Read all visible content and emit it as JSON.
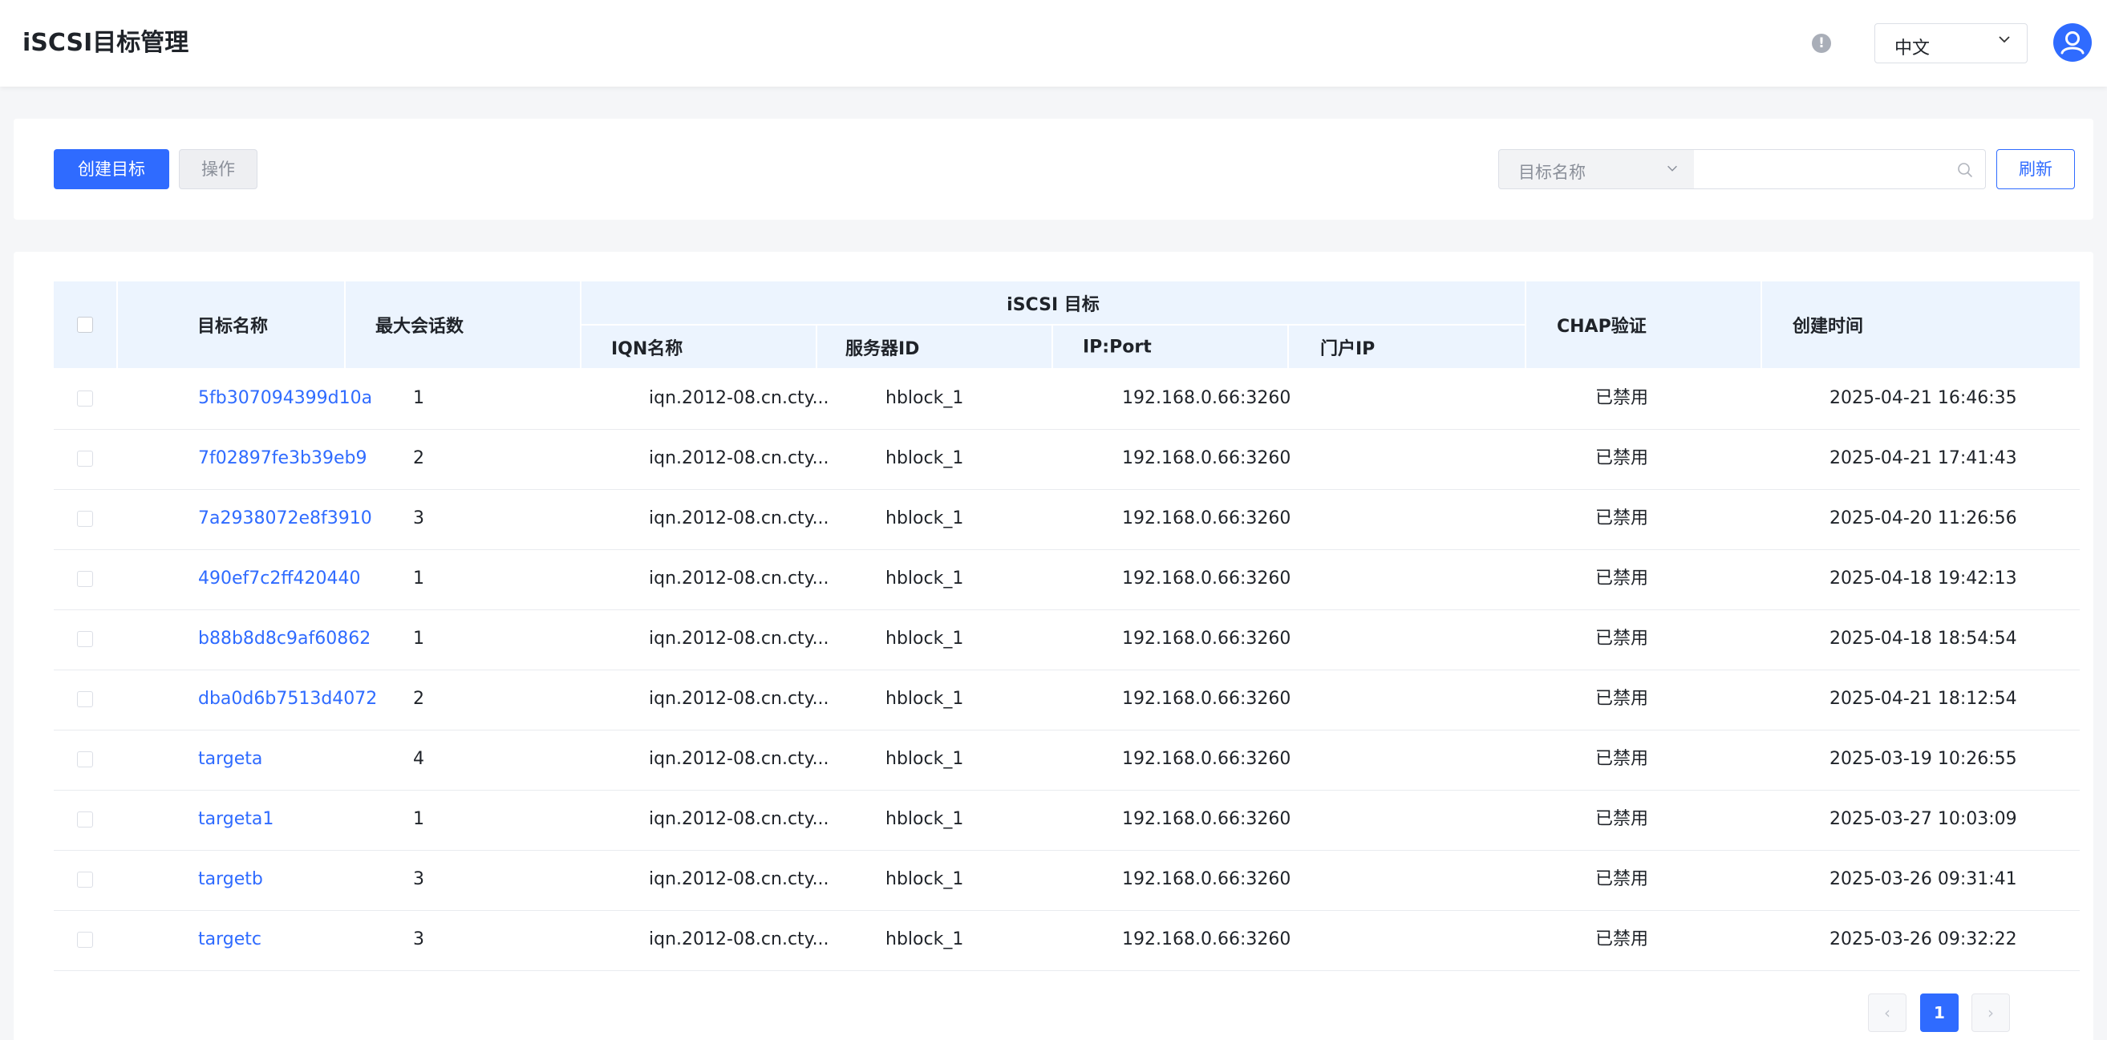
{
  "header": {
    "title": "iSCSI目标管理",
    "help_icon": "info-circle-icon",
    "help_glyph": "!",
    "language": "中文",
    "avatar_icon": "user-avatar-icon",
    "accent": "#2f6bff"
  },
  "toolbar": {
    "create_label": "创建目标",
    "action_label": "操作",
    "filter_value": "目标名称",
    "search_value": "",
    "refresh_label": "刷新"
  },
  "table": {
    "headers": {
      "name": "目标名称",
      "max_sessions": "最大会话数",
      "group": "iSCSI 目标",
      "iqn": "IQN名称",
      "server_id": "服务器ID",
      "ip_port": "IP:Port",
      "portal_ip": "门户IP",
      "chap": "CHAP验证",
      "created": "创建时间"
    },
    "rows": [
      {
        "name": "5fb307094399d10a",
        "max_sessions": "1",
        "iqn": "iqn.2012-08.cn.cty...",
        "server_id": "hblock_1",
        "ip_port": "192.168.0.66:3260",
        "portal_ip": "",
        "chap": "已禁用",
        "created": "2025-04-21 16:46:35"
      },
      {
        "name": "7f02897fe3b39eb9",
        "max_sessions": "2",
        "iqn": "iqn.2012-08.cn.cty...",
        "server_id": "hblock_1",
        "ip_port": "192.168.0.66:3260",
        "portal_ip": "",
        "chap": "已禁用",
        "created": "2025-04-21 17:41:43"
      },
      {
        "name": "7a2938072e8f3910",
        "max_sessions": "3",
        "iqn": "iqn.2012-08.cn.cty...",
        "server_id": "hblock_1",
        "ip_port": "192.168.0.66:3260",
        "portal_ip": "",
        "chap": "已禁用",
        "created": "2025-04-20 11:26:56"
      },
      {
        "name": "490ef7c2ff420440",
        "max_sessions": "1",
        "iqn": "iqn.2012-08.cn.cty...",
        "server_id": "hblock_1",
        "ip_port": "192.168.0.66:3260",
        "portal_ip": "",
        "chap": "已禁用",
        "created": "2025-04-18 19:42:13"
      },
      {
        "name": "b88b8d8c9af60862",
        "max_sessions": "1",
        "iqn": "iqn.2012-08.cn.cty...",
        "server_id": "hblock_1",
        "ip_port": "192.168.0.66:3260",
        "portal_ip": "",
        "chap": "已禁用",
        "created": "2025-04-18 18:54:54"
      },
      {
        "name": "dba0d6b7513d4072",
        "max_sessions": "2",
        "iqn": "iqn.2012-08.cn.cty...",
        "server_id": "hblock_1",
        "ip_port": "192.168.0.66:3260",
        "portal_ip": "",
        "chap": "已禁用",
        "created": "2025-04-21 18:12:54"
      },
      {
        "name": "targeta",
        "max_sessions": "4",
        "iqn": "iqn.2012-08.cn.cty...",
        "server_id": "hblock_1",
        "ip_port": "192.168.0.66:3260",
        "portal_ip": "",
        "chap": "已禁用",
        "created": "2025-03-19 10:26:55"
      },
      {
        "name": "targeta1",
        "max_sessions": "1",
        "iqn": "iqn.2012-08.cn.cty...",
        "server_id": "hblock_1",
        "ip_port": "192.168.0.66:3260",
        "portal_ip": "",
        "chap": "已禁用",
        "created": "2025-03-27 10:03:09"
      },
      {
        "name": "targetb",
        "max_sessions": "3",
        "iqn": "iqn.2012-08.cn.cty...",
        "server_id": "hblock_1",
        "ip_port": "192.168.0.66:3260",
        "portal_ip": "",
        "chap": "已禁用",
        "created": "2025-03-26 09:31:41"
      },
      {
        "name": "targetc",
        "max_sessions": "3",
        "iqn": "iqn.2012-08.cn.cty...",
        "server_id": "hblock_1",
        "ip_port": "192.168.0.66:3260",
        "portal_ip": "",
        "chap": "已禁用",
        "created": "2025-03-26 09:32:22"
      }
    ]
  },
  "pagination": {
    "prev_glyph": "‹",
    "current_page": "1",
    "next_glyph": "›"
  }
}
